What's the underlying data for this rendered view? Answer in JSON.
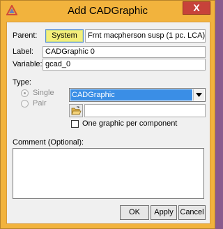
{
  "window": {
    "title": "Add CADGraphic",
    "close_symbol": "X",
    "app_icon": "hyperworks-triangle-icon"
  },
  "form": {
    "parent_label": "Parent:",
    "parent_button": "System",
    "parent_value": "Frnt macpherson susp (1 pc. LCA)",
    "label_label": "Label:",
    "label_value": "CADGraphic 0",
    "variable_label": "Variable:",
    "variable_value": "gcad_0",
    "type_label": "Type:",
    "type_options": [
      {
        "label": "Single",
        "selected": true
      },
      {
        "label": "Pair",
        "selected": false
      }
    ],
    "type_select_value": "CADGraphic",
    "file_value": "",
    "checkbox_label": "One graphic per component",
    "checkbox_checked": false,
    "comment_label": "Comment (Optional):",
    "comment_value": ""
  },
  "buttons": {
    "ok": "OK",
    "apply": "Apply",
    "cancel": "Cancel"
  },
  "colors": {
    "title_bar": "#f2b33d",
    "close_button": "#c7423a",
    "system_button": "#f4ee7a",
    "selection": "#3a8ee6"
  }
}
